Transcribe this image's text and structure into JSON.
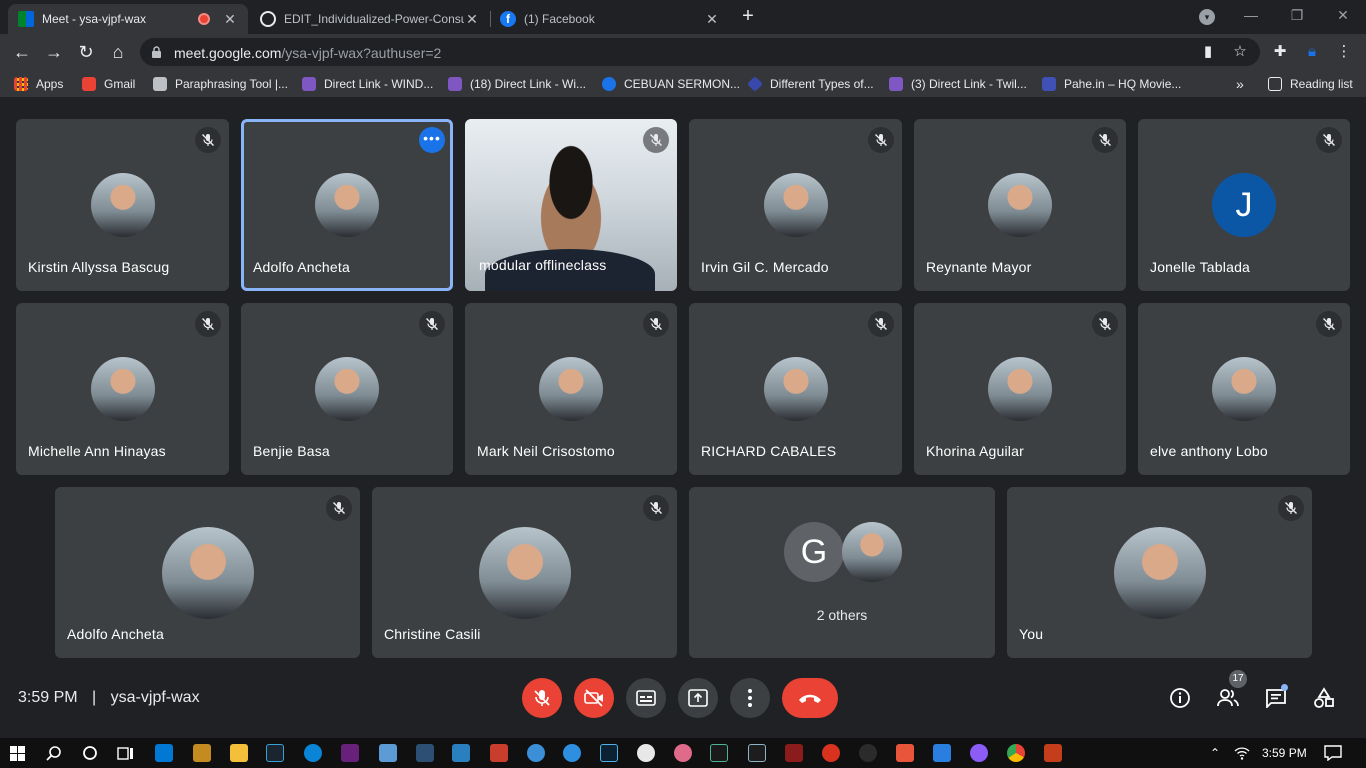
{
  "browser": {
    "tabs": [
      {
        "title": "Meet - ysa-vjpf-wax",
        "active": true
      },
      {
        "title": "EDIT_Individualized-Power-Consu",
        "active": false
      },
      {
        "title": "(1) Facebook",
        "active": false
      }
    ],
    "url": {
      "host": "meet.google.com",
      "path": "/ysa-vjpf-wax?authuser=2"
    },
    "bookmarks": [
      {
        "label": "Apps",
        "color": "#f4b400"
      },
      {
        "label": "Gmail",
        "color": "#ea4335"
      },
      {
        "label": "Paraphrasing Tool |...",
        "color": "#bdc1c6"
      },
      {
        "label": "Direct Link - WIND...",
        "color": "#7e57c2"
      },
      {
        "label": "(18) Direct Link - Wi...",
        "color": "#7e57c2"
      },
      {
        "label": "CEBUAN SERMON...",
        "color": "#1a73e8"
      },
      {
        "label": "Different Types of...",
        "color": "#3949ab"
      },
      {
        "label": "(3) Direct Link - Twil...",
        "color": "#7e57c2"
      },
      {
        "label": "Pahe.in – HQ Movie...",
        "color": "#3f51b5"
      }
    ],
    "reading_list": "Reading list"
  },
  "participants": [
    {
      "name": "Kirstin Allyssa Bascug",
      "avatar": "photo"
    },
    {
      "name": "Adolfo Ancheta",
      "avatar": "photo",
      "selected": true
    },
    {
      "name": "modular offlineclass",
      "avatar": "video"
    },
    {
      "name": "Irvin Gil C. Mercado",
      "avatar": "photo"
    },
    {
      "name": "Reynante Mayor",
      "avatar": "photo"
    },
    {
      "name": "Jonelle Tablada",
      "avatar": "letter",
      "letter": "J",
      "color": "#0b57a6"
    },
    {
      "name": "Michelle Ann Hinayas",
      "avatar": "photo"
    },
    {
      "name": "Benjie Basa",
      "avatar": "photo"
    },
    {
      "name": "Mark Neil Crisostomo",
      "avatar": "photo"
    },
    {
      "name": "RICHARD CABALES",
      "avatar": "photo"
    },
    {
      "name": "Khorina Aguilar",
      "avatar": "photo"
    },
    {
      "name": "elve anthony Lobo",
      "avatar": "photo"
    },
    {
      "name": "Adolfo Ancheta",
      "avatar": "photo"
    },
    {
      "name": "Christine Casili",
      "avatar": "photo"
    },
    {
      "name": "2 others",
      "avatar": "group",
      "letter": "G",
      "color": "#5f6368"
    },
    {
      "name": "You",
      "avatar": "photo"
    }
  ],
  "meeting": {
    "time": "3:59 PM",
    "separator": "|",
    "code": "ysa-vjpf-wax",
    "people_count": "17"
  },
  "taskbar": {
    "time": "3:59 PM"
  }
}
